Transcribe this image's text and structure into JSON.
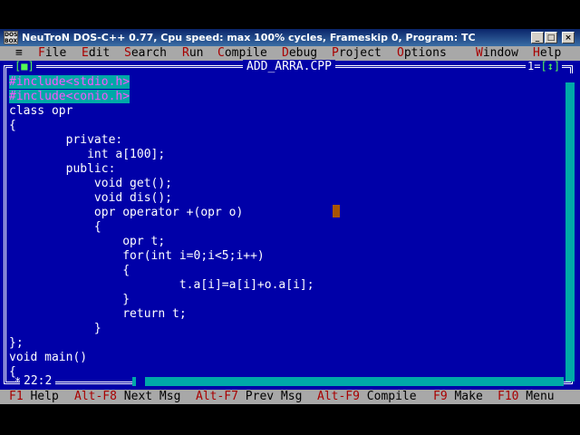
{
  "window": {
    "icon_text": "DOS BOX",
    "title": "NeuTroN DOS-C++ 0.77, Cpu speed: max 100% cycles, Frameskip  0, Program:   TC",
    "btn_min": "_",
    "btn_max": "□",
    "btn_close": "×"
  },
  "menu": {
    "system": "≡",
    "items": [
      {
        "hot": "F",
        "rest": "ile"
      },
      {
        "hot": "E",
        "rest": "dit"
      },
      {
        "hot": "S",
        "rest": "earch"
      },
      {
        "hot": "R",
        "rest": "un"
      },
      {
        "hot": "C",
        "rest": "ompile"
      },
      {
        "hot": "D",
        "rest": "ebug"
      },
      {
        "hot": "P",
        "rest": "roject"
      },
      {
        "hot": "O",
        "rest": "ptions"
      },
      {
        "hot": "W",
        "rest": "indow"
      },
      {
        "hot": "H",
        "rest": "elp"
      }
    ]
  },
  "editor": {
    "close_box": "[■]",
    "file_name": "ADD_ARRA.CPP",
    "win_num": "1",
    "zoom_box": "[↕]",
    "cursor_pos": "22:2",
    "lines": [
      "#include<stdio.h>",
      "#include<conio.h>",
      "class opr",
      "{",
      "        private:",
      "           int a[100];",
      "        public:",
      "            void get();",
      "            void dis();",
      "            opr operator +(opr o)",
      "            {",
      "                opr t;",
      "                for(int i=0;i<5;i++)",
      "                {",
      "                        t.a[i]=a[i]+o.a[i];",
      "                }",
      "                return t;",
      "            }",
      "};",
      "void main()",
      "{"
    ]
  },
  "status": [
    {
      "key": "F1",
      "label": " Help"
    },
    {
      "key": "Alt-F8",
      "label": " Next Msg"
    },
    {
      "key": "Alt-F7",
      "label": " Prev Msg"
    },
    {
      "key": "Alt-F9",
      "label": " Compile"
    },
    {
      "key": "F9",
      "label": " Make"
    },
    {
      "key": "F10",
      "label": " Menu"
    }
  ],
  "colors": {
    "editor_bg": "#0000a8",
    "menu_bg": "#a8a8a8",
    "hotkey": "#a80000",
    "highlight": "#00a8a8"
  }
}
